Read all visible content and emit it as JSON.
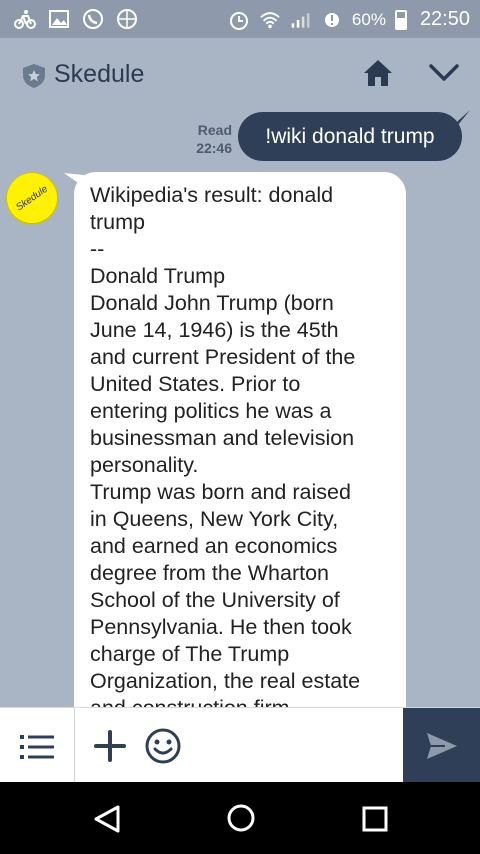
{
  "status_bar": {
    "icons": [
      "bike-icon",
      "image-icon",
      "whatsapp-icon",
      "data-icon",
      "alarm-icon",
      "wifi-icon",
      "signal-icon",
      "sync-icon",
      "battery-icon"
    ],
    "battery": "60%",
    "time": "22:50"
  },
  "header": {
    "title": "Skedule"
  },
  "chat": {
    "outgoing": {
      "read_label": "Read",
      "time": "22:46",
      "text": "!wiki donald trump"
    },
    "avatar_text": "Skedule",
    "incoming_lines": [
      "Wikipedia's result: donald",
      "trump",
      "--",
      "Donald Trump",
      "Donald John Trump (born",
      "June 14, 1946) is the 45th",
      "and current President of the",
      "United States. Prior to",
      "entering politics he was a",
      "businessman and television",
      "personality.",
      "Trump was born and raised",
      "in Queens, New York City,",
      "and earned an economics",
      "degree from the Wharton",
      "School of the University of",
      "Pennsylvania. He then took",
      "charge of The Trump",
      "Organization, the real estate",
      "and construction firm"
    ]
  },
  "colors": {
    "background": "#a9b4c4",
    "bubble_dark": "#2f3f58",
    "avatar_yellow": "#fff200"
  }
}
